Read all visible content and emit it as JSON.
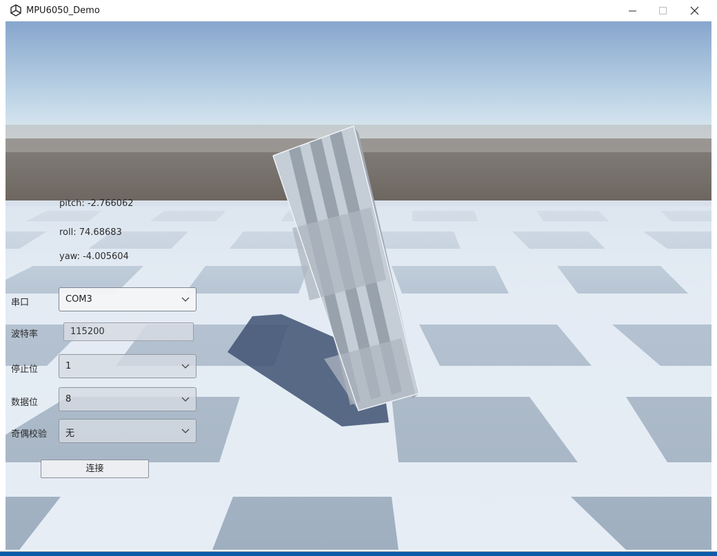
{
  "window": {
    "title": "MPU6050_Demo",
    "app_icon": "unity-icon"
  },
  "readouts": {
    "pitch": "pitch: -2.766062",
    "roll": "roll: 74.68683",
    "yaw": "yaw: -4.005604"
  },
  "form": {
    "port_label": "串口",
    "port_value": "COM3",
    "baud_label": "波特率",
    "baud_value": "115200",
    "stopbits_label": "停止位",
    "stopbits_value": "1",
    "databits_label": "数据位",
    "databits_value": "8",
    "parity_label": "奇偶校验",
    "parity_value": "无",
    "connect_label": "连接"
  },
  "colors": {
    "sky_top": "#8aa9cf",
    "sky_horizon": "#e3edf2",
    "ground": "#6b645f",
    "floor_light": "#e8eef5",
    "floor_dark": "#aab8c8"
  }
}
